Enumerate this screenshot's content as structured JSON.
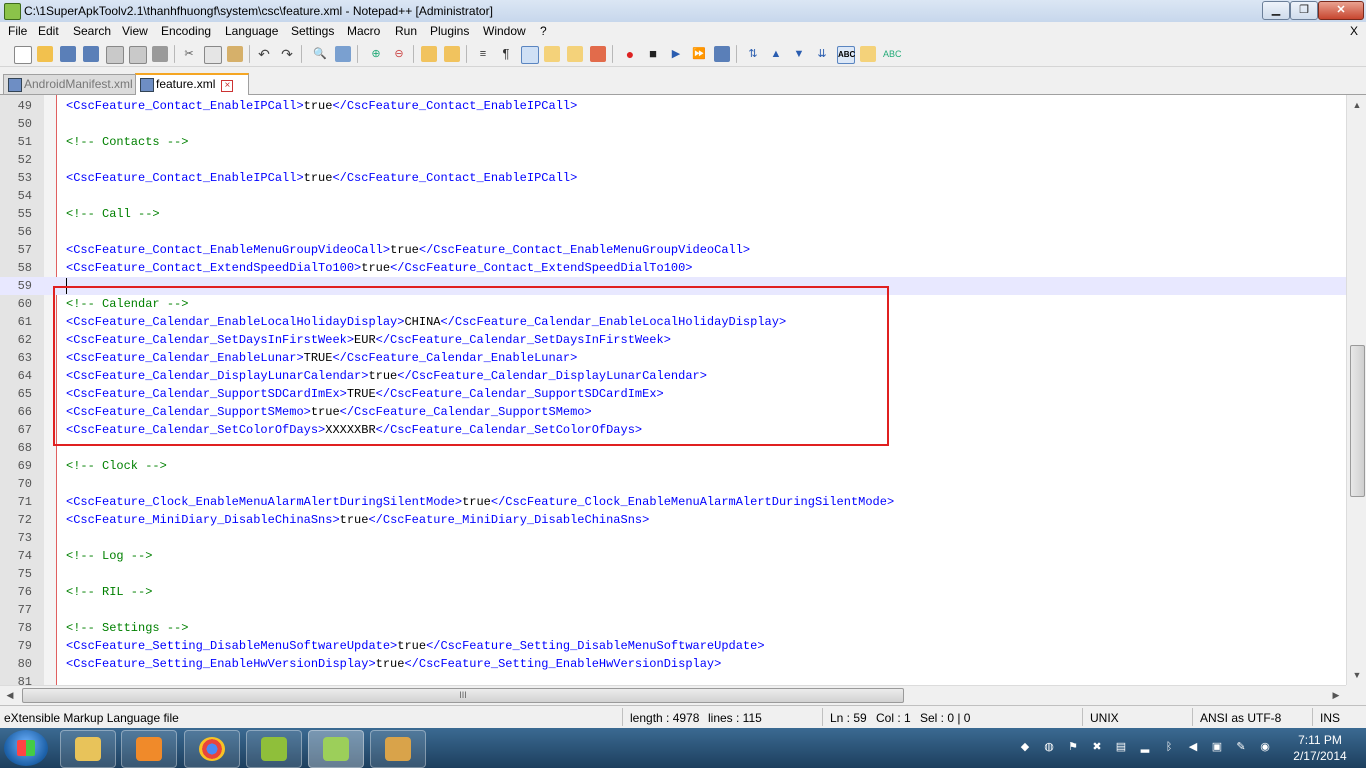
{
  "window": {
    "title": "C:\\1SuperApkToolv2.1\\thanhfhuongf\\system\\csc\\feature.xml - Notepad++ [Administrator]",
    "minimize": "▁",
    "maximize": "❐",
    "close": "✕"
  },
  "menu": {
    "items": [
      "File",
      "Edit",
      "Search",
      "View",
      "Encoding",
      "Language",
      "Settings",
      "Macro",
      "Run",
      "Plugins",
      "Window",
      "?"
    ],
    "close": "X"
  },
  "tabs": [
    {
      "label": "AndroidManifest.xml",
      "active": false
    },
    {
      "label": "feature.xml",
      "active": true
    }
  ],
  "editor": {
    "lines": [
      {
        "n": "49",
        "type": "elem",
        "open": "<CscFeature_Contact_EnableIPCall>",
        "val": "true",
        "close": "</CscFeature_Contact_EnableIPCall>"
      },
      {
        "n": "50",
        "type": "blank"
      },
      {
        "n": "51",
        "type": "comment",
        "text": "<!-- Contacts -->"
      },
      {
        "n": "52",
        "type": "blank"
      },
      {
        "n": "53",
        "type": "elem",
        "open": "<CscFeature_Contact_EnableIPCall>",
        "val": "true",
        "close": "</CscFeature_Contact_EnableIPCall>"
      },
      {
        "n": "54",
        "type": "blank"
      },
      {
        "n": "55",
        "type": "comment",
        "text": "<!-- Call -->"
      },
      {
        "n": "56",
        "type": "blank"
      },
      {
        "n": "57",
        "type": "elem",
        "open": "<CscFeature_Contact_EnableMenuGroupVideoCall>",
        "val": "true",
        "close": "</CscFeature_Contact_EnableMenuGroupVideoCall>"
      },
      {
        "n": "58",
        "type": "elem",
        "open": "<CscFeature_Contact_ExtendSpeedDialTo100>",
        "val": "true",
        "close": "</CscFeature_Contact_ExtendSpeedDialTo100>"
      },
      {
        "n": "59",
        "type": "blank",
        "current": true
      },
      {
        "n": "60",
        "type": "comment",
        "text": "<!-- Calendar -->"
      },
      {
        "n": "61",
        "type": "elem",
        "open": "<CscFeature_Calendar_EnableLocalHolidayDisplay>",
        "val": "CHINA",
        "close": "</CscFeature_Calendar_EnableLocalHolidayDisplay>"
      },
      {
        "n": "62",
        "type": "elem",
        "open": "<CscFeature_Calendar_SetDaysInFirstWeek>",
        "val": "EUR",
        "close": "</CscFeature_Calendar_SetDaysInFirstWeek>"
      },
      {
        "n": "63",
        "type": "elem",
        "open": "<CscFeature_Calendar_EnableLunar>",
        "val": "TRUE",
        "close": "</CscFeature_Calendar_EnableLunar>"
      },
      {
        "n": "64",
        "type": "elem",
        "open": "<CscFeature_Calendar_DisplayLunarCalendar>",
        "val": "true",
        "close": "</CscFeature_Calendar_DisplayLunarCalendar>"
      },
      {
        "n": "65",
        "type": "elem",
        "open": "<CscFeature_Calendar_SupportSDCardImEx>",
        "val": "TRUE",
        "close": "</CscFeature_Calendar_SupportSDCardImEx>"
      },
      {
        "n": "66",
        "type": "elem",
        "open": "<CscFeature_Calendar_SupportSMemo>",
        "val": "true",
        "close": "</CscFeature_Calendar_SupportSMemo>"
      },
      {
        "n": "67",
        "type": "elem",
        "open": "<CscFeature_Calendar_SetColorOfDays>",
        "val": "XXXXXBR",
        "close": "</CscFeature_Calendar_SetColorOfDays>"
      },
      {
        "n": "68",
        "type": "blank"
      },
      {
        "n": "69",
        "type": "comment",
        "text": "<!-- Clock -->"
      },
      {
        "n": "70",
        "type": "blank"
      },
      {
        "n": "71",
        "type": "elem",
        "open": "<CscFeature_Clock_EnableMenuAlarmAlertDuringSilentMode>",
        "val": "true",
        "close": "</CscFeature_Clock_EnableMenuAlarmAlertDuringSilentMode>"
      },
      {
        "n": "72",
        "type": "elem",
        "open": "<CscFeature_MiniDiary_DisableChinaSns>",
        "val": "true",
        "close": "</CscFeature_MiniDiary_DisableChinaSns>"
      },
      {
        "n": "73",
        "type": "blank"
      },
      {
        "n": "74",
        "type": "comment",
        "text": "<!-- Log -->"
      },
      {
        "n": "75",
        "type": "blank"
      },
      {
        "n": "76",
        "type": "comment",
        "text": "<!-- RIL -->"
      },
      {
        "n": "77",
        "type": "blank"
      },
      {
        "n": "78",
        "type": "comment",
        "text": "<!-- Settings -->"
      },
      {
        "n": "79",
        "type": "elem",
        "open": "<CscFeature_Setting_DisableMenuSoftwareUpdate>",
        "val": "true",
        "close": "</CscFeature_Setting_DisableMenuSoftwareUpdate>"
      },
      {
        "n": "80",
        "type": "elem",
        "open": "<CscFeature_Setting_EnableHwVersionDisplay>",
        "val": "true",
        "close": "</CscFeature_Setting_EnableHwVersionDisplay>"
      },
      {
        "n": "81",
        "type": "blank"
      }
    ]
  },
  "scroll": {
    "hthumb_grip": "III",
    "up": "▲",
    "down": "▼",
    "left": "◀",
    "right": "▶"
  },
  "status": {
    "filetype": "eXtensible Markup Language file",
    "length": "length : 4978",
    "lines": "lines : 115",
    "ln": "Ln : 59",
    "col": "Col : 1",
    "sel": "Sel : 0 | 0",
    "eol": "UNIX",
    "encoding": "ANSI as UTF-8",
    "mode": "INS"
  },
  "taskbar": {
    "clock_time": "7:11 PM",
    "clock_date": "2/17/2014"
  },
  "colors": {
    "tag": "#0000ff",
    "comment": "#008000",
    "highlight": "#e02020"
  }
}
